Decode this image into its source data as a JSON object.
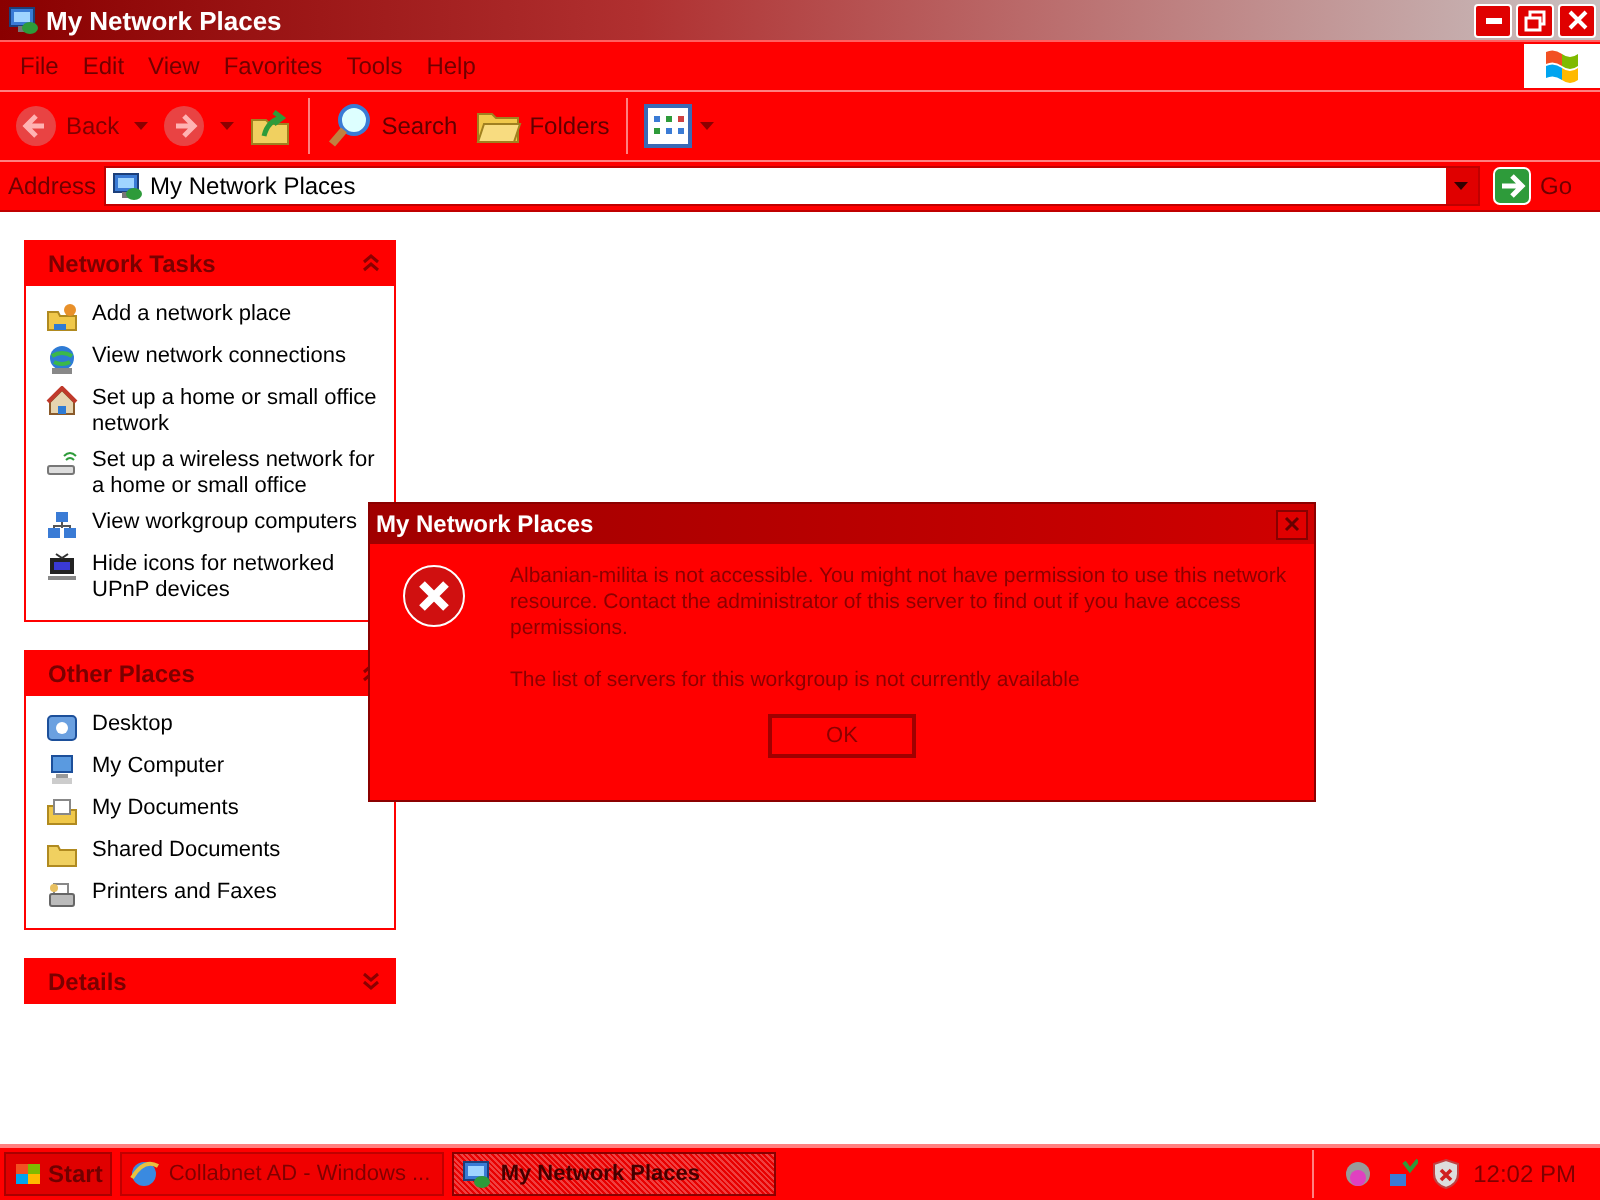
{
  "window": {
    "title": "My Network Places"
  },
  "menu": [
    "File",
    "Edit",
    "View",
    "Favorites",
    "Tools",
    "Help"
  ],
  "toolbar": [
    {
      "kind": "back",
      "label": "Back",
      "disabled": true
    },
    {
      "kind": "forward",
      "disabled": true
    },
    {
      "kind": "up"
    },
    {
      "kind": "search",
      "label": "Search"
    },
    {
      "kind": "folders",
      "label": "Folders"
    },
    {
      "kind": "views"
    }
  ],
  "address": {
    "label": "Address",
    "value": "My Network Places",
    "go": "Go"
  },
  "panels": [
    {
      "title": "Network Tasks",
      "expanded": true,
      "items": [
        {
          "kind": "add",
          "label": "Add a network place"
        },
        {
          "kind": "connections",
          "label": "View network connections"
        },
        {
          "kind": "home",
          "label": "Set up a home or small office network"
        },
        {
          "kind": "wireless",
          "label": "Set up a wireless network for a home or small office"
        },
        {
          "kind": "workgroup",
          "label": "View workgroup computers"
        },
        {
          "kind": "upnp",
          "label": "Hide icons for networked UPnP devices"
        }
      ]
    },
    {
      "title": "Other Places",
      "expanded": true,
      "items": [
        {
          "kind": "desktop",
          "label": "Desktop"
        },
        {
          "kind": "computer",
          "label": "My Computer"
        },
        {
          "kind": "documents",
          "label": "My Documents"
        },
        {
          "kind": "shared",
          "label": "Shared Documents"
        },
        {
          "kind": "printers",
          "label": "Printers and Faxes"
        }
      ]
    },
    {
      "title": "Details",
      "expanded": false
    }
  ],
  "dialog": {
    "title": "My Network Places",
    "messages": [
      "Albanian-milita is not accessible. You might not have permission to use this network resource. Contact the administrator of this server to find out if you have access permissions.",
      "The list of servers for this workgroup is not currently available"
    ],
    "button": "OK"
  },
  "taskbar": {
    "start": "Start",
    "tasks": [
      {
        "kind": "browser",
        "label": "Collabnet AD - Windows ...",
        "selected": false
      },
      {
        "kind": "network",
        "label": "My Network Places",
        "selected": true
      }
    ],
    "clock": "12:02 PM"
  }
}
